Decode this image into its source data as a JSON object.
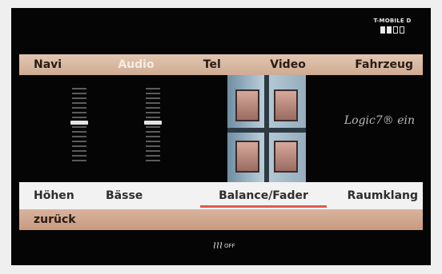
{
  "status": {
    "operator": "T-MOBILE D",
    "signal": {
      "bars_total": 4,
      "bars_on": 2
    }
  },
  "top_menu": {
    "items": [
      {
        "label": "Navi"
      },
      {
        "label": "Audio",
        "active": true
      },
      {
        "label": "Tel"
      },
      {
        "label": "Video"
      },
      {
        "label": "Fahrzeug"
      }
    ]
  },
  "content": {
    "logic7_label": "Logic7® ein",
    "balance_level": 0.45,
    "fader_level": 0.45
  },
  "tabs": [
    {
      "label": "Höhen"
    },
    {
      "label": "Bässe"
    },
    {
      "label": "Balance/Fader",
      "active": true
    },
    {
      "label": "Raumklang"
    }
  ],
  "back_bar": {
    "label": "zurück"
  },
  "bottom_status": {
    "text": "OFF"
  },
  "colors": {
    "menu_bg": "#d8b8a2",
    "back_bg": "#d0a58c",
    "active_tab_underline": "#e05a4b"
  }
}
